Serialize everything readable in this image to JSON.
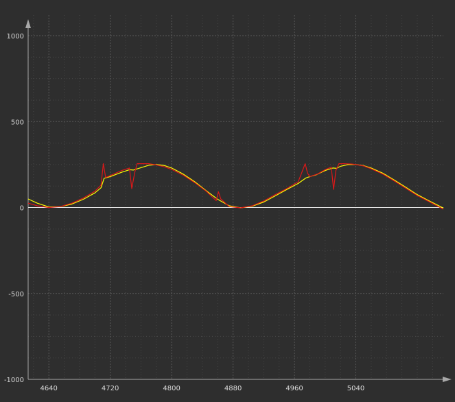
{
  "chart_data": {
    "type": "line",
    "title": "",
    "xlabel": "",
    "ylabel": "",
    "xlim": [
      4613,
      5154
    ],
    "ylim": [
      -1000,
      1000
    ],
    "x_ticks": [
      4640,
      4720,
      4800,
      4880,
      4960,
      5040
    ],
    "y_ticks": [
      1000,
      500,
      0,
      -500,
      -1000
    ],
    "x_tick_labels": [
      "4640",
      "4720",
      "4800",
      "4880",
      "4960",
      "5040"
    ],
    "y_tick_labels": [
      "1000",
      "500",
      "0",
      "-500",
      "-1000"
    ],
    "grid": true,
    "legend": "none",
    "background_color": "#2e2e2e",
    "series": [
      {
        "color": "#ffff00",
        "x": [
          4613,
          4625,
          4640,
          4655,
          4670,
          4685,
          4700,
          4708,
          4712,
          4720,
          4735,
          4745,
          4750,
          4760,
          4770,
          4780,
          4790,
          4800,
          4815,
          4830,
          4845,
          4860,
          4875,
          4890,
          4905,
          4920,
          4935,
          4950,
          4965,
          4975,
          4980,
          4988,
          5000,
          5010,
          5015,
          5020,
          5030,
          5040,
          5050,
          5060,
          5075,
          5090,
          5105,
          5120,
          5135,
          5154
        ],
        "y": [
          50,
          25,
          3,
          5,
          20,
          48,
          85,
          115,
          170,
          180,
          205,
          220,
          218,
          232,
          246,
          250,
          245,
          230,
          195,
          150,
          98,
          48,
          10,
          -2,
          8,
          32,
          68,
          105,
          140,
          172,
          180,
          190,
          215,
          230,
          228,
          240,
          250,
          250,
          244,
          230,
          200,
          160,
          118,
          75,
          40,
          -3
        ]
      },
      {
        "color": "#e01818",
        "x": [
          4613,
          4625,
          4640,
          4655,
          4670,
          4685,
          4700,
          4708,
          4711,
          4714,
          4718,
          4722,
          4735,
          4745,
          4748,
          4752,
          4755,
          4760,
          4770,
          4780,
          4790,
          4800,
          4815,
          4830,
          4845,
          4858,
          4861,
          4864,
          4875,
          4890,
          4905,
          4920,
          4935,
          4950,
          4965,
          4974,
          4977,
          4980,
          4984,
          4990,
          5000,
          5008,
          5011,
          5014,
          5018,
          5025,
          5035,
          5040,
          5050,
          5060,
          5075,
          5090,
          5105,
          5120,
          5135,
          5154
        ],
        "y": [
          25,
          10,
          0,
          5,
          25,
          55,
          95,
          130,
          255,
          175,
          182,
          190,
          215,
          230,
          110,
          205,
          255,
          255,
          255,
          248,
          238,
          222,
          188,
          145,
          95,
          40,
          92,
          50,
          5,
          -2,
          10,
          38,
          75,
          110,
          150,
          255,
          200,
          180,
          186,
          195,
          220,
          235,
          105,
          215,
          255,
          255,
          253,
          250,
          242,
          225,
          195,
          155,
          112,
          70,
          35,
          -10
        ]
      }
    ]
  }
}
